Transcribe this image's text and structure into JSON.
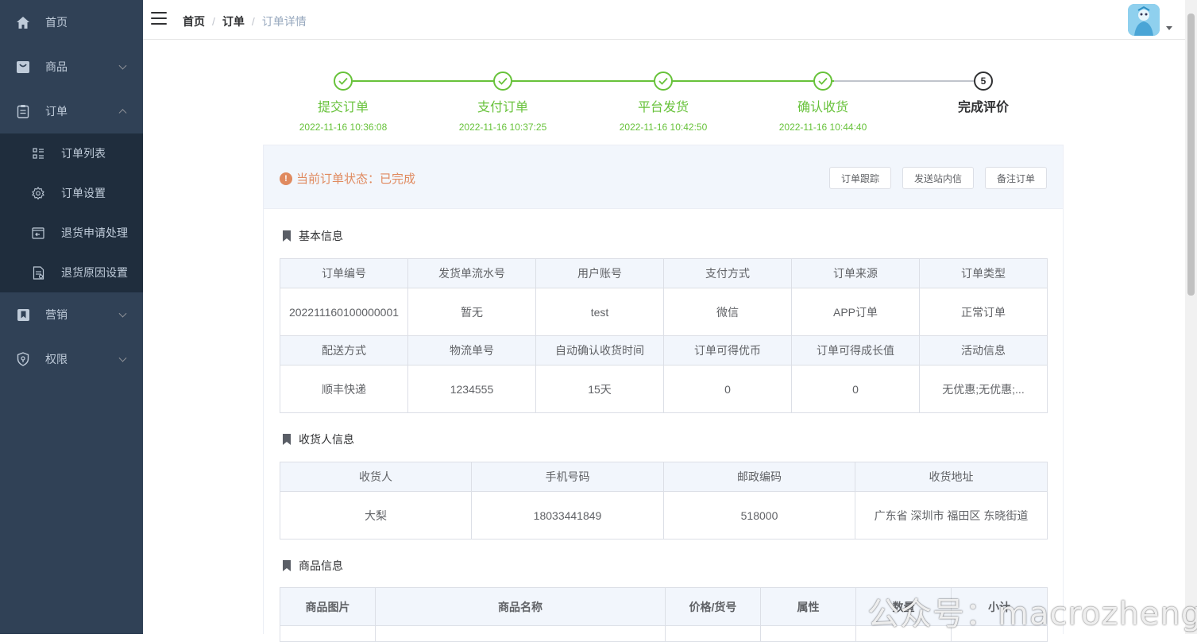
{
  "sidebar": {
    "items": [
      {
        "label": "首页",
        "icon": "home-icon"
      },
      {
        "label": "商品",
        "icon": "shopping-bag-icon"
      },
      {
        "label": "订单",
        "icon": "clipboard-icon"
      },
      {
        "label": "营销",
        "icon": "bookmark-icon"
      },
      {
        "label": "权限",
        "icon": "shield-icon"
      }
    ],
    "order_sub": [
      {
        "label": "订单列表",
        "icon": "list-icon"
      },
      {
        "label": "订单设置",
        "icon": "gear-icon"
      },
      {
        "label": "退货申请处理",
        "icon": "return-icon"
      },
      {
        "label": "退货原因设置",
        "icon": "document-icon"
      }
    ]
  },
  "breadcrumb": {
    "home": "首页",
    "order": "订单",
    "current": "订单详情"
  },
  "steps": [
    {
      "title": "提交订单",
      "time": "2022-11-16 10:36:08"
    },
    {
      "title": "支付订单",
      "time": "2022-11-16 10:37:25"
    },
    {
      "title": "平台发货",
      "time": "2022-11-16 10:42:50"
    },
    {
      "title": "确认收货",
      "time": "2022-11-16 10:44:40"
    },
    {
      "title": "完成评价",
      "number": "5"
    }
  ],
  "status": {
    "label": "当前订单状态：",
    "value": "已完成"
  },
  "buttons": {
    "track": "订单跟踪",
    "message": "发送站内信",
    "remark": "备注订单"
  },
  "basic": {
    "title": "基本信息",
    "headers1": [
      "订单编号",
      "发货单流水号",
      "用户账号",
      "支付方式",
      "订单来源",
      "订单类型"
    ],
    "values1": [
      "202211160100000001",
      "暂无",
      "test",
      "微信",
      "APP订单",
      "正常订单"
    ],
    "headers2": [
      "配送方式",
      "物流单号",
      "自动确认收货时间",
      "订单可得优币",
      "订单可得成长值",
      "活动信息"
    ],
    "values2": [
      "顺丰快递",
      "1234555",
      "15天",
      "0",
      "0",
      "无优惠;无优惠;..."
    ]
  },
  "receiver": {
    "title": "收货人信息",
    "headers": [
      "收货人",
      "手机号码",
      "邮政编码",
      "收货地址"
    ],
    "values": [
      "大梨",
      "18033441849",
      "518000",
      "广东省 深圳市 福田区 东晓街道"
    ]
  },
  "goods": {
    "title": "商品信息",
    "headers": [
      "商品图片",
      "商品名称",
      "价格/货号",
      "属性",
      "数量",
      "小计"
    ]
  },
  "watermark": "公众号：macrozheng",
  "colors": {
    "sidebar": "#304156",
    "submenu": "#1f2d3d",
    "success": "#67c23a",
    "warning": "#e08a5f"
  }
}
